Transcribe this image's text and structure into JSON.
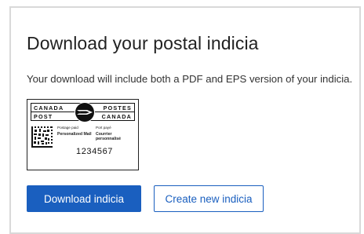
{
  "card": {
    "title": "Download your postal indicia",
    "description": "Your download will include both a PDF and EPS version of your indicia."
  },
  "indicia": {
    "canada_left": "CANADA",
    "postes": "POSTES",
    "post": "POST",
    "canada_right": "CANADA",
    "postage_paid_en": "Postage paid",
    "postage_paid_fr": "Port payé",
    "product_en": "Personalized Mail",
    "product_fr": "Courrier personnalisé",
    "number": "1234567"
  },
  "buttons": {
    "download_label": "Download indicia",
    "create_label": "Create new indicia"
  },
  "colors": {
    "accent": "#1a5fbf",
    "border": "#d9d9d9"
  },
  "icons": {
    "logo": "canada-post-logo-icon",
    "barcode": "datamatrix-barcode-icon"
  }
}
